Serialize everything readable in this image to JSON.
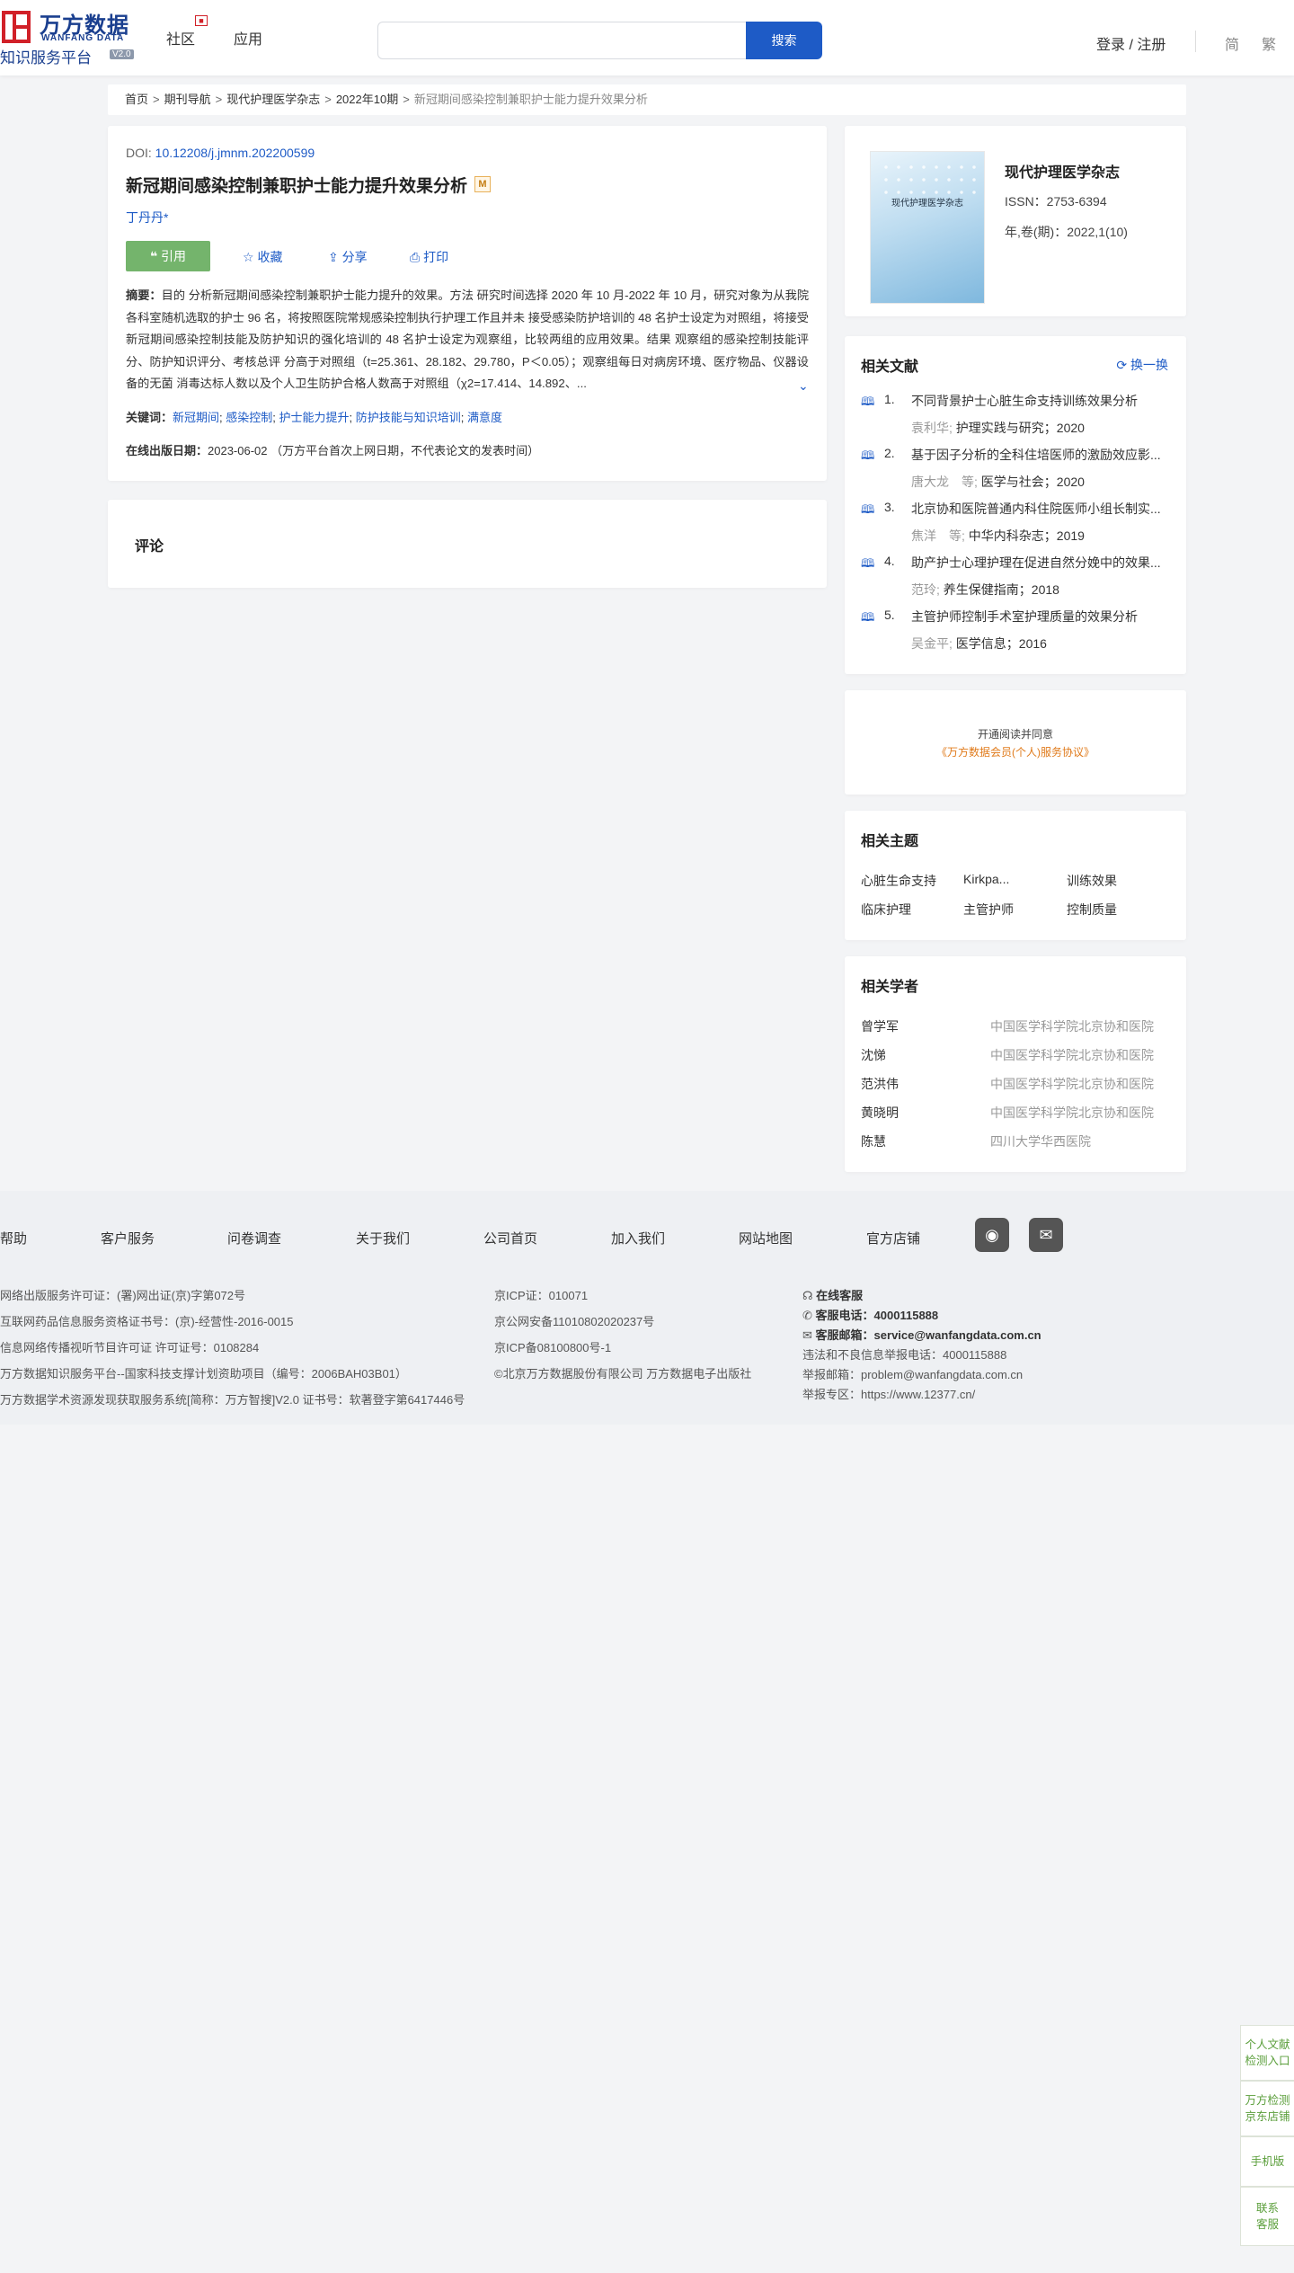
{
  "header": {
    "logo_cn": "万方数据",
    "logo_en": "WANFANG DATA",
    "logo_sub": "知识服务平台",
    "logo_version": "V2.0",
    "nav": [
      "社区",
      "应用"
    ],
    "search_placeholder": "",
    "search_button": "搜索",
    "login": "登录 / 注册",
    "lang_simplified": "简",
    "lang_traditional": "繁"
  },
  "breadcrumb": [
    "首页",
    "期刊导航",
    "现代护理医学杂志",
    "2022年10期",
    "新冠期间感染控制兼职护士能力提升效果分析"
  ],
  "article": {
    "doi_label": "DOI: ",
    "doi": "10.12208/j.jmnm.202200599",
    "title": "新冠期间感染控制兼职护士能力提升效果分析",
    "m_badge": "M",
    "author": "丁丹丹*",
    "actions": {
      "cite": "引用",
      "collect": "收藏",
      "share": "分享",
      "print": "打印"
    },
    "abstract_label": "摘要：",
    "abstract": "目的 分析新冠期间感染控制兼职护士能力提升的效果。方法 研究时间选择 2020 年 10 月-2022 年 10 月，研究对象为从我院各科室随机选取的护士 96 名，将按照医院常规感染控制执行护理工作且并未 接受感染防护培训的 48 名护士设定为对照组，将接受新冠期间感染控制技能及防护知识的强化培训的 48 名护士设定为观察组，比较两组的应用效果。结果 观察组的感染控制技能评分、防护知识评分、考核总评 分高于对照组（t=25.361、28.182、29.780，P＜0.05）；观察组每日对病房环境、医疗物品、仪器设备的无菌 消毒达标人数以及个人卫生防护合格人数高于对照组（χ2=17.414、14.892、...",
    "keywords_label": "关键词：",
    "keywords": [
      "新冠期间",
      "感染控制",
      "护士能力提升",
      "防护技能与知识培训",
      "满意度"
    ],
    "pubdate_label": "在线出版日期：",
    "pubdate": "2023-06-02 （万方平台首次上网日期，不代表论文的发表时间）"
  },
  "comment": {
    "title": "评论"
  },
  "journal": {
    "cover_title": "现代护理医学杂志",
    "name": "现代护理医学杂志",
    "issn": "ISSN：2753-6394",
    "year_issue": "年,卷(期)：2022,1(10)"
  },
  "related_docs": {
    "title": "相关文献",
    "refresh": "换一换",
    "items": [
      {
        "num": "1.",
        "title": "不同背景护士心脏生命支持训练效果分析",
        "authors": "袁利华;",
        "source": " 护理实践与研究；2020"
      },
      {
        "num": "2.",
        "title": "基于因子分析的全科住培医师的激励效应影...",
        "authors": "唐大龙　等;",
        "source": " 医学与社会；2020"
      },
      {
        "num": "3.",
        "title": "北京协和医院普通内科住院医师小组长制实...",
        "authors": "焦洋　等;",
        "source": " 中华内科杂志；2019"
      },
      {
        "num": "4.",
        "title": "助产护士心理护理在促进自然分娩中的效果...",
        "authors": "范玲;",
        "source": " 养生保健指南；2018"
      },
      {
        "num": "5.",
        "title": "主管护师控制手术室护理质量的效果分析",
        "authors": "吴金平;",
        "source": " 医学信息；2016"
      }
    ]
  },
  "open_read": {
    "line1": "开通阅读并同意",
    "line2": "《万方数据会员(个人)服务协议》"
  },
  "topics": {
    "title": "相关主题",
    "items": [
      "心脏生命支持",
      "Kirkpa...",
      "训练效果",
      "临床护理",
      "主管护师",
      "控制质量"
    ]
  },
  "scholars": {
    "title": "相关学者",
    "items": [
      {
        "name": "曾学军",
        "org": "中国医学科学院北京协和医院"
      },
      {
        "name": "沈悌",
        "org": "中国医学科学院北京协和医院"
      },
      {
        "name": "范洪伟",
        "org": "中国医学科学院北京协和医院"
      },
      {
        "name": "黄晓明",
        "org": "中国医学科学院北京协和医院"
      },
      {
        "name": "陈慧",
        "org": "四川大学华西医院"
      }
    ]
  },
  "footer": {
    "links": [
      "帮助",
      "客户服务",
      "问卷调查",
      "关于我们",
      "公司首页",
      "加入我们",
      "网站地图",
      "官方店铺"
    ],
    "col1": [
      "网络出版服务许可证：(署)网出证(京)字第072号",
      "互联网药品信息服务资格证书号：(京)-经营性-2016-0015",
      "信息网络传播视听节目许可证 许可证号：0108284",
      "万方数据知识服务平台--国家科技支撑计划资助项目（编号：2006BAH03B01）",
      "万方数据学术资源发现获取服务系统[简称：万方智搜]V2.0 证书号：软著登字第6417446号"
    ],
    "col2": [
      "京ICP证：010071",
      "京公网安备11010802020237号",
      "京ICP备08100800号-1",
      "©北京万方数据股份有限公司 万方数据电子出版社"
    ],
    "online_service": "在线客服",
    "phone_label": "客服电话：",
    "phone": "4000115888",
    "email_label": "客服邮箱：",
    "email": "service@wanfangdata.com.cn",
    "col3": [
      "违法和不良信息举报电话：4000115888",
      "举报邮箱：problem@wanfangdata.com.cn",
      "举报专区：https://www.12377.cn/"
    ]
  },
  "float_bar": [
    "个人文献检测入口",
    "万方检测京东店铺",
    "手机版",
    "联系客服"
  ]
}
